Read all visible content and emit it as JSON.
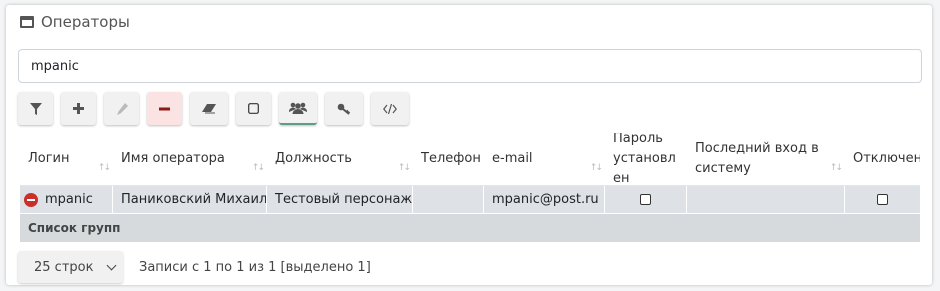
{
  "panel": {
    "title": "Операторы"
  },
  "search": {
    "value": "mpanic"
  },
  "toolbar": {
    "buttons": [
      {
        "name": "filter-button",
        "icon": "filter-icon"
      },
      {
        "name": "add-button",
        "icon": "plus-icon"
      },
      {
        "name": "edit-button",
        "icon": "pencil-icon",
        "disabled": true
      },
      {
        "name": "delete-button",
        "icon": "minus-icon",
        "accent": "#fbe3e3"
      },
      {
        "name": "clear-button",
        "icon": "eraser-icon"
      },
      {
        "name": "select-button",
        "icon": "square-icon"
      },
      {
        "name": "groups-button",
        "icon": "users-icon"
      },
      {
        "name": "key-button",
        "icon": "key-icon"
      },
      {
        "name": "code-button",
        "icon": "code-icon"
      }
    ]
  },
  "table": {
    "columns": [
      "Логин",
      "Имя оператора",
      "Должность",
      "Телефон",
      "e-mail",
      "Пароль установлен",
      "Последний вход в систему",
      "Отключен"
    ],
    "rows": [
      {
        "login": "mpanic",
        "name": "Паниковский Михаил",
        "position": "Тестовый персонаж",
        "phone": "",
        "email": "mpanic@post.ru",
        "password_set": false,
        "last_login": "",
        "disabled": false
      }
    ],
    "group_row_label": "Список групп"
  },
  "footer": {
    "page_size": "25 строк",
    "records_info": "Записи с 1 по 1 из 1 [выделено 1]"
  },
  "colors": {
    "row_bg": "#dee2e6",
    "delete_accent": "#c9302c",
    "groups_accent": "#5f9c87"
  }
}
